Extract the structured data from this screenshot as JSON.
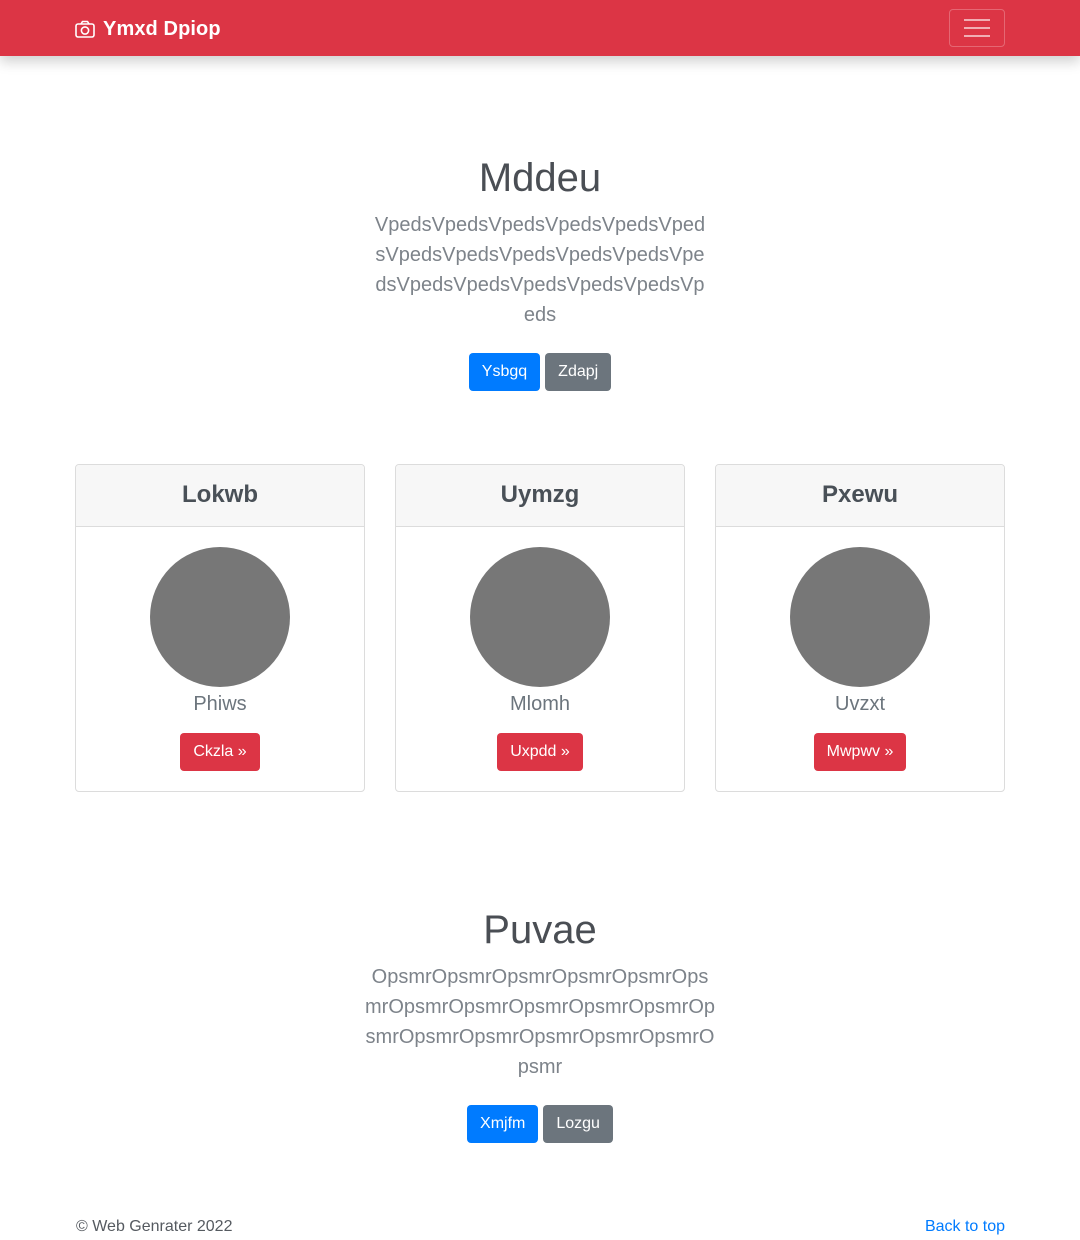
{
  "navbar": {
    "brand": "Ymxd Dpiop",
    "brand_icon": "camera-icon",
    "toggler_icon": "hamburger-menu-icon",
    "color": "#dc3545"
  },
  "hero": {
    "title": "Mddeu",
    "lead": "VpedsVpedsVpedsVpedsVpedsVpedsVpedsVpedsVpedsVpedsVpedsVpedsVpedsVpedsVpedsVpedsVpedsVpeds",
    "primary_label": "Ysbgq",
    "secondary_label": "Zdapj"
  },
  "cards": [
    {
      "title": "Lokwb",
      "name": "Phiws",
      "button_label": "Ckzla »"
    },
    {
      "title": "Uymzg",
      "name": "Mlomh",
      "button_label": "Uxpdd »"
    },
    {
      "title": "Pxewu",
      "name": "Uvzxt",
      "button_label": "Mwpwv »"
    }
  ],
  "section2": {
    "title": "Puvae",
    "lead": "OpsmrOpsmrOpsmrOpsmrOpsmrOpsmrOpsmrOpsmrOpsmrOpsmrOpsmrOpsmrOpsmrOpsmrOpsmrOpsmrOpsmrOpsmr",
    "primary_label": "Xmjfm",
    "secondary_label": "Lozgu"
  },
  "footer": {
    "copyright": "© Web Genrater 2022",
    "back_to_top": "Back to top"
  },
  "colors": {
    "primary": "#007bff",
    "secondary": "#6c757d",
    "danger": "#dc3545",
    "avatar": "#777777"
  }
}
